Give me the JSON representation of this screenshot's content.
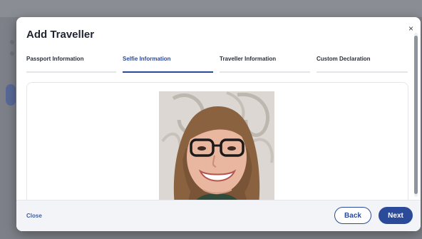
{
  "modal": {
    "title": "Add Traveller",
    "close_icon": "×"
  },
  "tabs": [
    {
      "label": "Passport Information",
      "active": false
    },
    {
      "label": "Selfie Information",
      "active": true
    },
    {
      "label": "Traveller Information",
      "active": false
    },
    {
      "label": "Custom Declaration",
      "active": false
    }
  ],
  "footer": {
    "close_label": "Close",
    "back_label": "Back",
    "next_label": "Next"
  },
  "colors": {
    "accent": "#2b4a9a",
    "overlay": "#7d8088"
  },
  "icons": {
    "close": "close-icon"
  }
}
